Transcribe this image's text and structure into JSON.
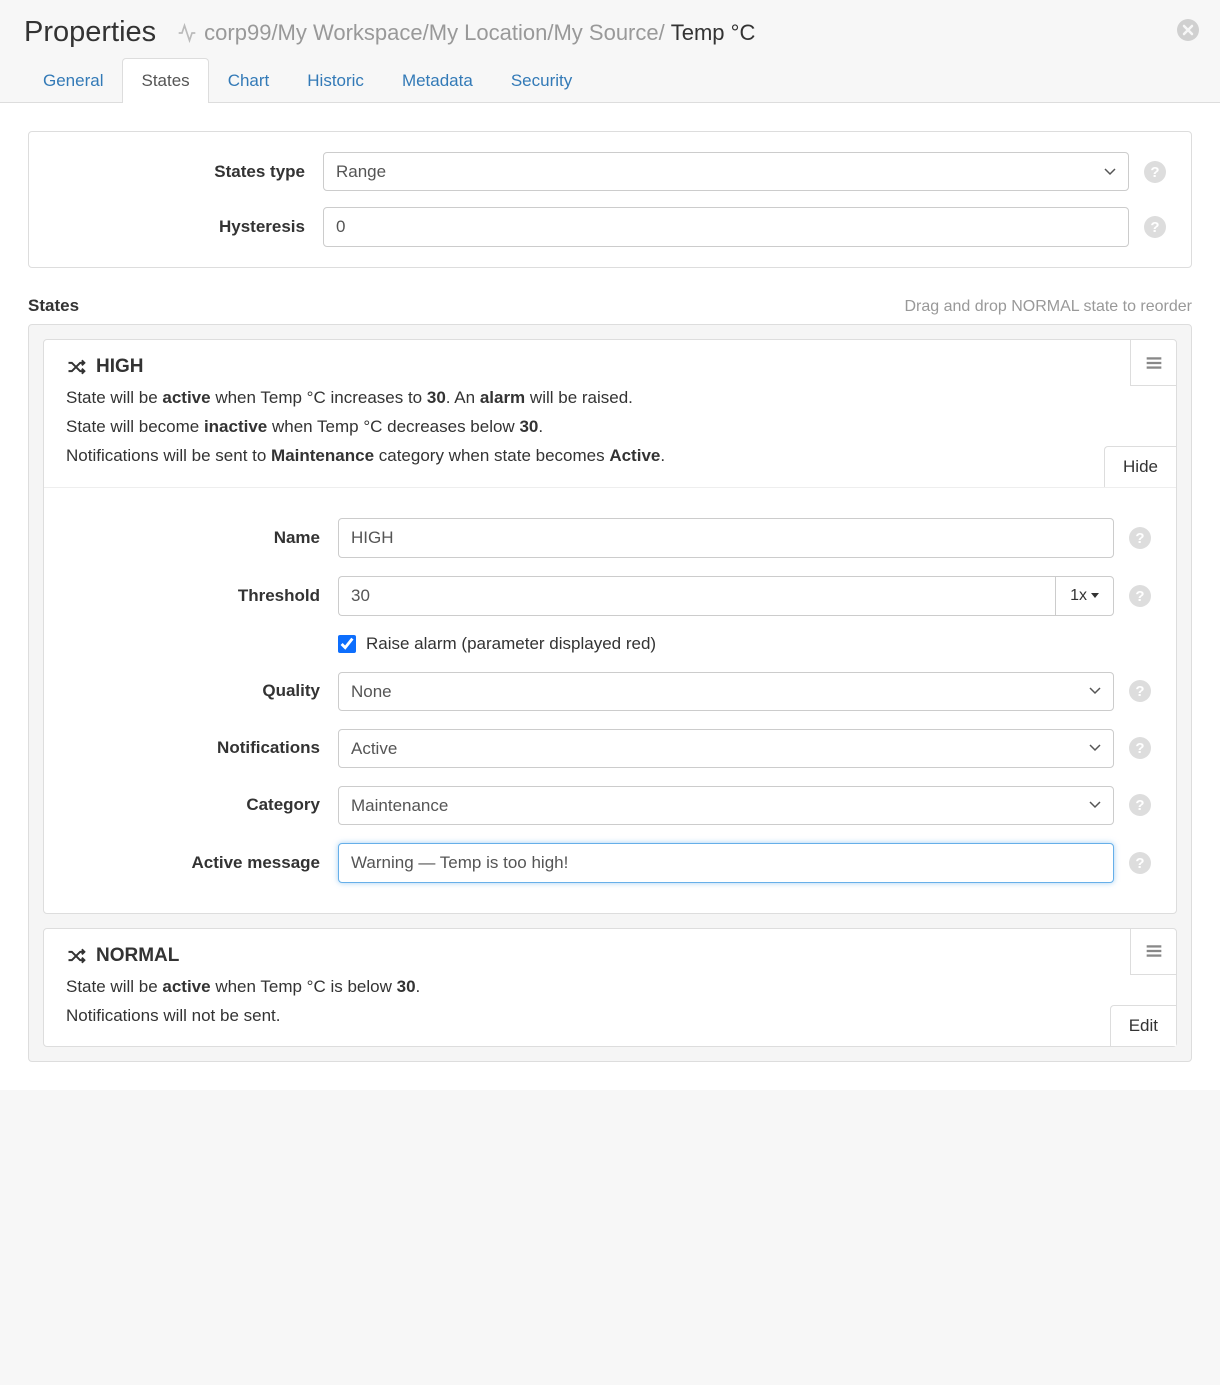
{
  "header": {
    "title": "Properties",
    "breadcrumb_gray": "corp99/My Workspace/My Location/My Source/",
    "breadcrumb_dark": "Temp °C"
  },
  "tabs": {
    "items": [
      "General",
      "States",
      "Chart",
      "Historic",
      "Metadata",
      "Security"
    ],
    "active": "States"
  },
  "top_form": {
    "states_type_label": "States type",
    "states_type_value": "Range",
    "hysteresis_label": "Hysteresis",
    "hysteresis_value": "0"
  },
  "states_section": {
    "title": "States",
    "hint": "Drag and drop NORMAL state to reorder"
  },
  "state_high": {
    "title": "HIGH",
    "desc_line1_a": "State will be ",
    "desc_line1_b": "active",
    "desc_line1_c": " when Temp °C increases to ",
    "desc_line1_d": "30",
    "desc_line1_e": ". An ",
    "desc_line1_f": "alarm",
    "desc_line1_g": " will be raised.",
    "desc_line2_a": "State will become ",
    "desc_line2_b": "inactive",
    "desc_line2_c": " when Temp °C decreases below ",
    "desc_line2_d": "30",
    "desc_line2_e": ".",
    "desc_line3_a": "Notifications will be sent to ",
    "desc_line3_b": "Maintenance",
    "desc_line3_c": " category when state becomes ",
    "desc_line3_d": "Active",
    "desc_line3_e": ".",
    "hide_label": "Hide",
    "form": {
      "name_label": "Name",
      "name_value": "HIGH",
      "threshold_label": "Threshold",
      "threshold_value": "30",
      "threshold_mult": "1x",
      "raise_alarm_label": "Raise alarm (parameter displayed red)",
      "raise_alarm_checked": true,
      "quality_label": "Quality",
      "quality_value": "None",
      "notifications_label": "Notifications",
      "notifications_value": "Active",
      "category_label": "Category",
      "category_value": "Maintenance",
      "active_message_label": "Active message",
      "active_message_value": "Warning — Temp is too high!"
    }
  },
  "state_normal": {
    "title": "NORMAL",
    "desc_line1_a": "State will be ",
    "desc_line1_b": "active",
    "desc_line1_c": " when Temp °C is below ",
    "desc_line1_d": "30",
    "desc_line1_e": ".",
    "desc_line2": "Notifications will not be sent.",
    "edit_label": "Edit"
  }
}
